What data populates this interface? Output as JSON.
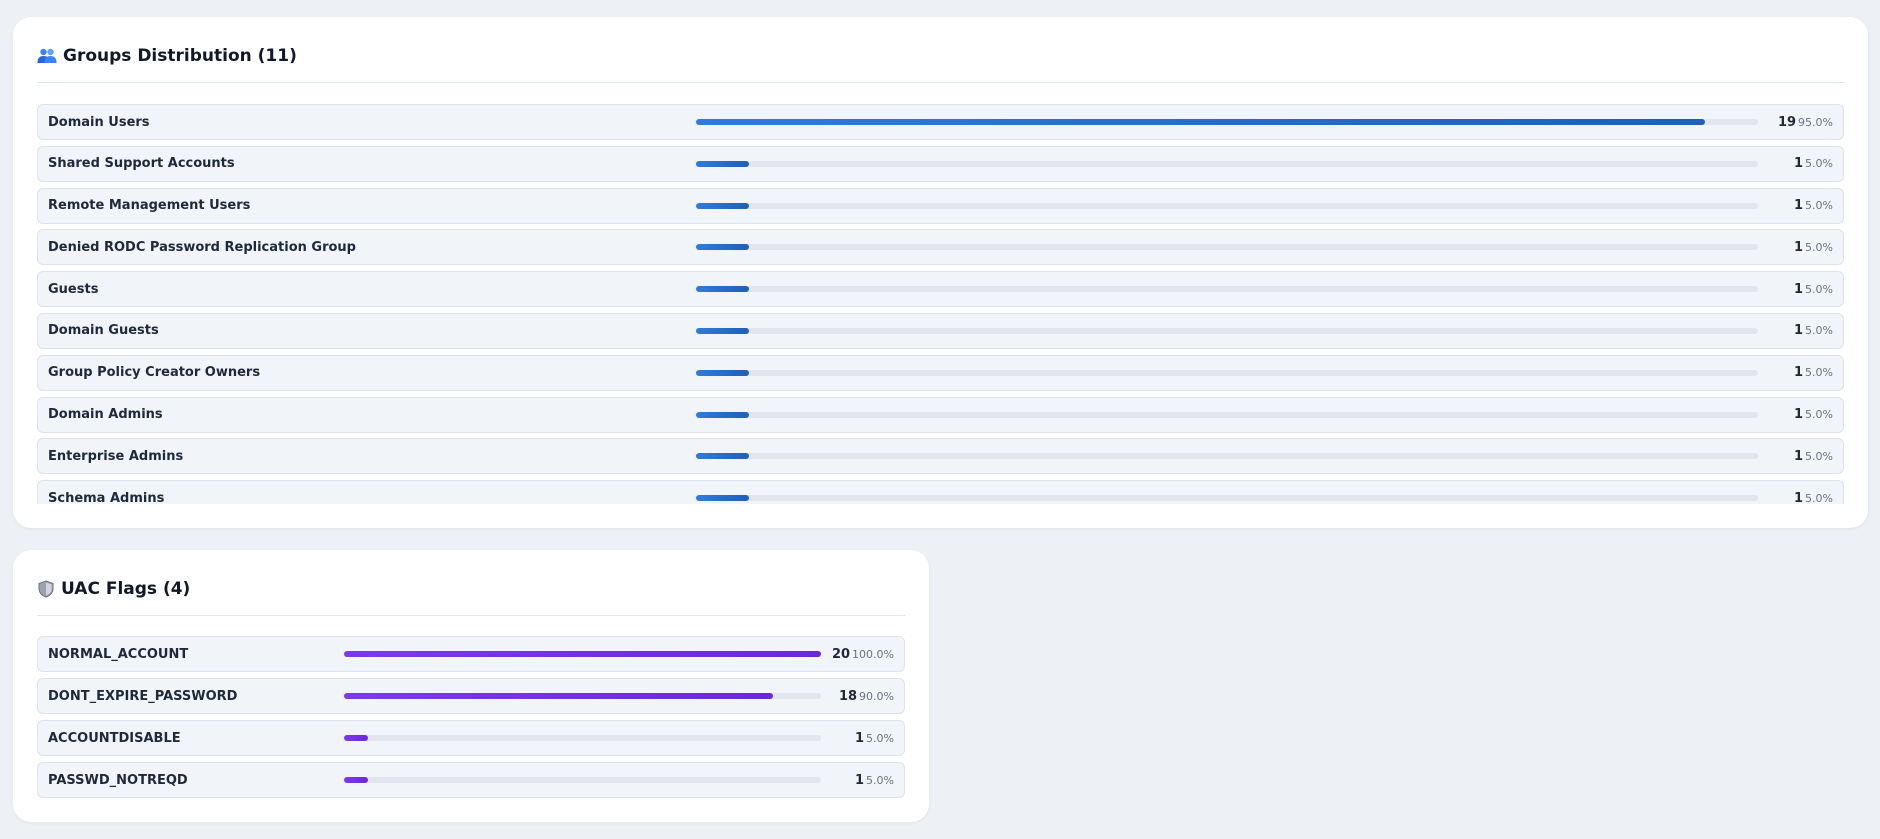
{
  "groups": {
    "title": "Groups Distribution (11)",
    "icon": "people-icon",
    "items": [
      {
        "label": "Domain Users",
        "count": "19",
        "pct": "95.0%",
        "fraction": 0.95
      },
      {
        "label": "Shared Support Accounts",
        "count": "1",
        "pct": "5.0%",
        "fraction": 0.05
      },
      {
        "label": "Remote Management Users",
        "count": "1",
        "pct": "5.0%",
        "fraction": 0.05
      },
      {
        "label": "Denied RODC Password Replication Group",
        "count": "1",
        "pct": "5.0%",
        "fraction": 0.05
      },
      {
        "label": "Guests",
        "count": "1",
        "pct": "5.0%",
        "fraction": 0.05
      },
      {
        "label": "Domain Guests",
        "count": "1",
        "pct": "5.0%",
        "fraction": 0.05
      },
      {
        "label": "Group Policy Creator Owners",
        "count": "1",
        "pct": "5.0%",
        "fraction": 0.05
      },
      {
        "label": "Domain Admins",
        "count": "1",
        "pct": "5.0%",
        "fraction": 0.05
      },
      {
        "label": "Enterprise Admins",
        "count": "1",
        "pct": "5.0%",
        "fraction": 0.05
      },
      {
        "label": "Schema Admins",
        "count": "1",
        "pct": "5.0%",
        "fraction": 0.05
      }
    ]
  },
  "uac": {
    "title": "UAC Flags (4)",
    "icon": "shield-icon",
    "items": [
      {
        "label": "NORMAL_ACCOUNT",
        "count": "20",
        "pct": "100.0%",
        "fraction": 1.0
      },
      {
        "label": "DONT_EXPIRE_PASSWORD",
        "count": "18",
        "pct": "90.0%",
        "fraction": 0.9
      },
      {
        "label": "ACCOUNTDISABLE",
        "count": "1",
        "pct": "5.0%",
        "fraction": 0.05
      },
      {
        "label": "PASSWD_NOTREQD",
        "count": "1",
        "pct": "5.0%",
        "fraction": 0.05
      }
    ]
  },
  "colors": {
    "groups_bar": "#2468c8",
    "uac_bar": "#7434e4",
    "track": "#e2e6ec",
    "row_bg": "#f1f4f9"
  }
}
